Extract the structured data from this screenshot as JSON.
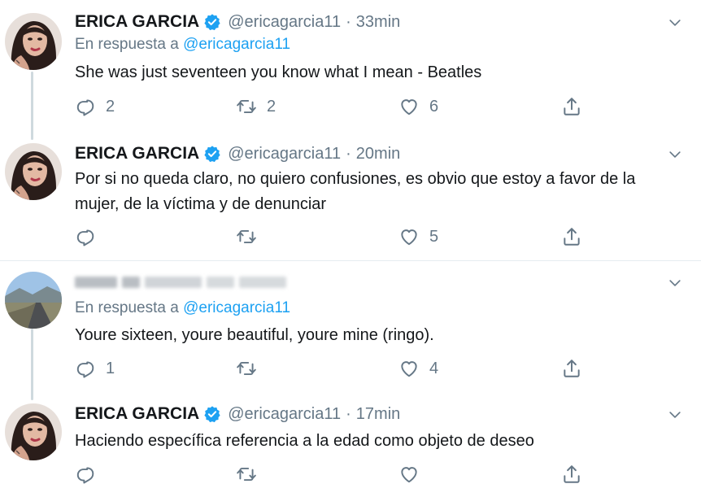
{
  "tweets": [
    {
      "author": "ERICA GARCIA",
      "handle": "@ericagarcia11",
      "time": "33min",
      "verified": true,
      "reply_prefix": "En respuesta a",
      "reply_mention": "@ericagarcia11",
      "text": "She was just seventeen you know what I mean - Beatles",
      "replies": "2",
      "retweets": "2",
      "likes": "6"
    },
    {
      "author": "ERICA GARCIA",
      "handle": "@ericagarcia11",
      "time": "20min",
      "verified": true,
      "text": "Por si no queda claro, no quiero confusiones, es obvio que estoy a favor de la mujer, de la víctima y de denunciar",
      "replies": "",
      "retweets": "",
      "likes": "5"
    },
    {
      "author": "",
      "handle": "",
      "time": "",
      "verified": false,
      "reply_prefix": "En respuesta a",
      "reply_mention": "@ericagarcia11",
      "text": "Youre sixteen, youre beautiful, youre mine (ringo).",
      "replies": "1",
      "retweets": "",
      "likes": "4"
    },
    {
      "author": "ERICA GARCIA",
      "handle": "@ericagarcia11",
      "time": "17min",
      "verified": true,
      "text": "Haciendo específica referencia a la edad como objeto de deseo",
      "replies": "",
      "retweets": "",
      "likes": ""
    }
  ],
  "separator": "·",
  "colors": {
    "accent": "#1da1f2",
    "muted": "#657786",
    "text": "#14171a",
    "divider": "#e6ecf0"
  },
  "icons": {
    "reply": "reply-icon",
    "retweet": "retweet-icon",
    "like": "heart-icon",
    "share": "share-icon",
    "menu": "chevron-down-icon",
    "verified": "verified-badge-icon"
  }
}
